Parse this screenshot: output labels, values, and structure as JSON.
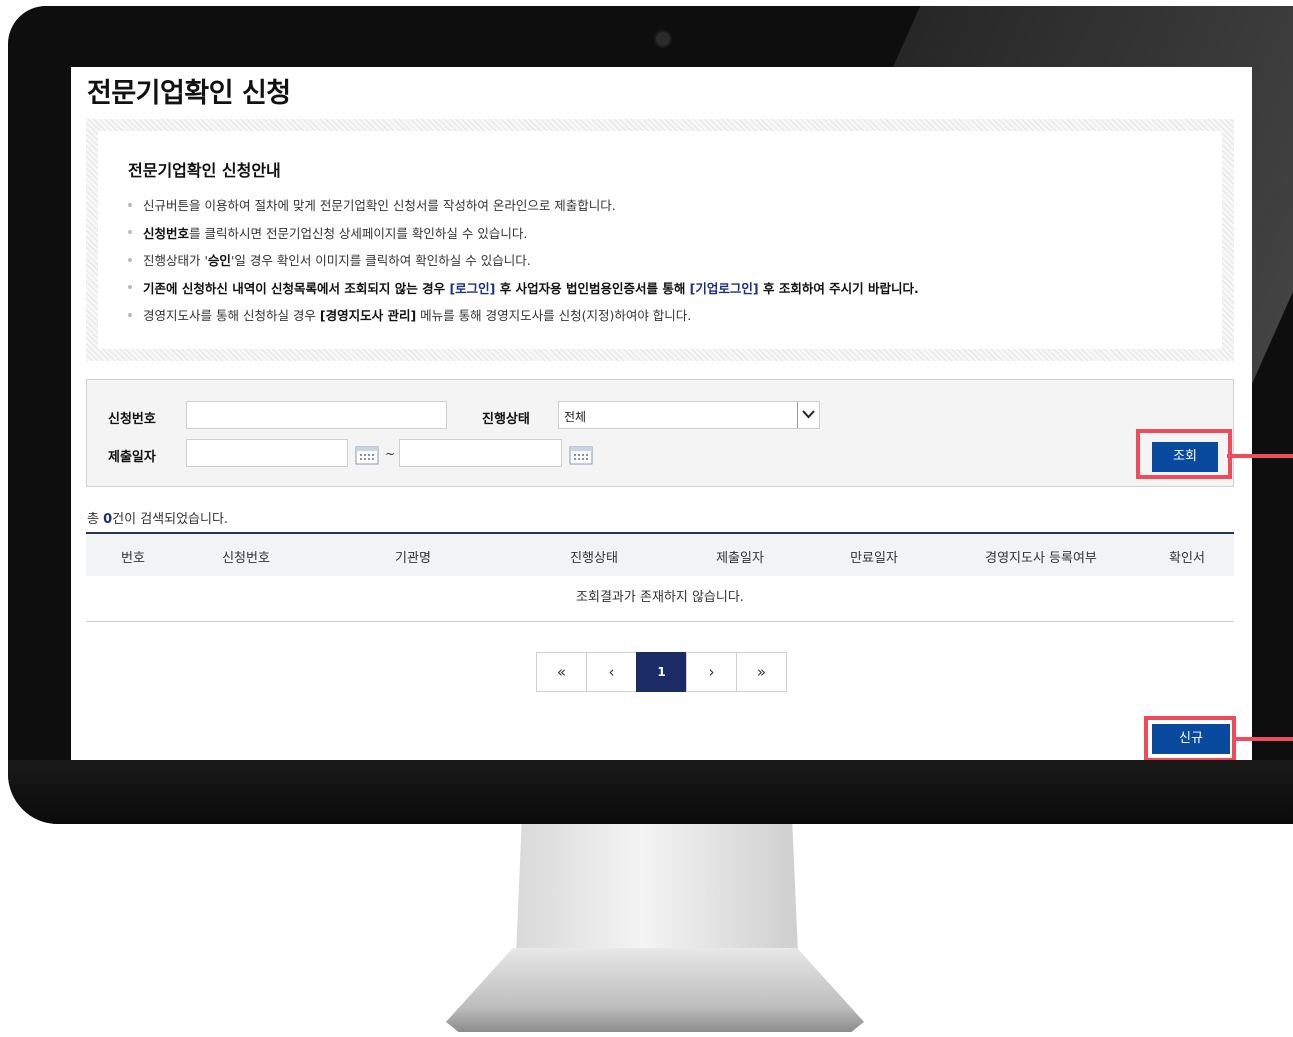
{
  "page": {
    "title": "전문기업확인 신청"
  },
  "guide": {
    "title": "전문기업확인 신청안내",
    "items": [
      {
        "text": "신규버튼을 이용하여 절차에 맞게 전문기업확인 신청서를 작성하여 온라인으로 제출합니다."
      },
      {
        "bold": "신청번호",
        "text": "를 클릭하시면 전문기업신청 상세페이지를 확인하실 수 있습니다."
      },
      {
        "pre": "진행상태가 '",
        "bold": "승인",
        "text": "'일 경우 확인서 이미지를 클릭하여 확인하실 수 있습니다."
      },
      {
        "bold": "기존에 신청하신 내역이 신청목록에서 조회되지 않는 경우 ",
        "link1": "[로그인]",
        "mid": " 후 사업자용 법인범용인증서를 통해 ",
        "link2": "[기업로그인]",
        "tail": " 후 조회하여 주시기 바랍니다."
      },
      {
        "pre": "경영지도사를 통해 신청하실 경우 ",
        "bold": "[경영지도사 관리]",
        "text": " 메뉴를 통해 경영지도사를 신청(지정)하여야 합니다."
      }
    ]
  },
  "search": {
    "app_no_label": "신청번호",
    "app_no_value": "",
    "status_label": "진행상태",
    "status_selected": "전체",
    "submit_date_label": "제출일자",
    "date_from": "",
    "date_to": "",
    "tilde": "~",
    "search_button": "조회"
  },
  "results": {
    "prefix": "총 ",
    "count": "0",
    "suffix": "건이 검색되었습니다.",
    "columns": [
      "번호",
      "신청번호",
      "기관명",
      "진행상태",
      "제출일자",
      "만료일자",
      "경영지도사 등록여부",
      "확인서"
    ],
    "empty_message": "조회결과가 존재하지 않습니다."
  },
  "pagination": {
    "first": "«",
    "prev": "‹",
    "current": "1",
    "next": "›",
    "last": "»"
  },
  "actions": {
    "new_button": "신규"
  },
  "colors": {
    "primary_button": "#0a4a9e",
    "highlight": "#ef4b5b",
    "active_page": "#1b2b66",
    "link": "#1b2f7e"
  }
}
